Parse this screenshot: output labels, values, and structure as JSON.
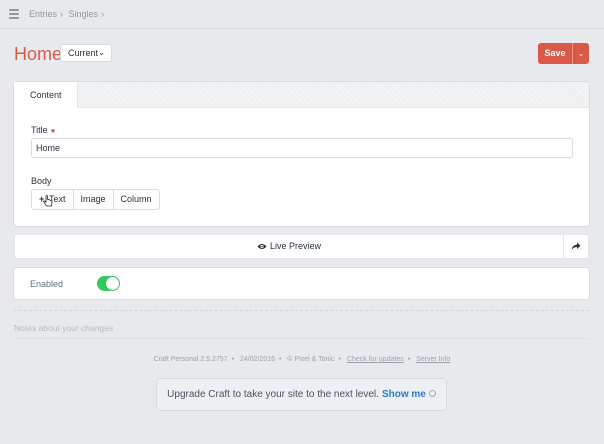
{
  "breadcrumb": [
    "Entries",
    "Singles"
  ],
  "header": {
    "title": "Home",
    "status_label": "Current",
    "save_label": "Save"
  },
  "tabs": [
    {
      "label": "Content"
    }
  ],
  "fields": {
    "title_label": "Title",
    "title_value": "Home",
    "body_label": "Body",
    "body_buttons": [
      "Text",
      "Image",
      "Column"
    ]
  },
  "preview": {
    "label": "Live Preview"
  },
  "enabled": {
    "label": "Enabled",
    "value": true
  },
  "notes_placeholder": "Notes about your changes",
  "footer": {
    "version": "Craft Personal 2.5.2757",
    "date": "24/02/2016",
    "vendor": "© Pixel & Tonic",
    "check_updates": "Check for updates",
    "server_info": "Server Info"
  },
  "upgrade": {
    "text": "Upgrade Craft to take your site to the next level.",
    "link": "Show me"
  },
  "colors": {
    "accent": "#da5a47",
    "toggle_on": "#2fcc5b",
    "link": "#2a7ad4"
  }
}
